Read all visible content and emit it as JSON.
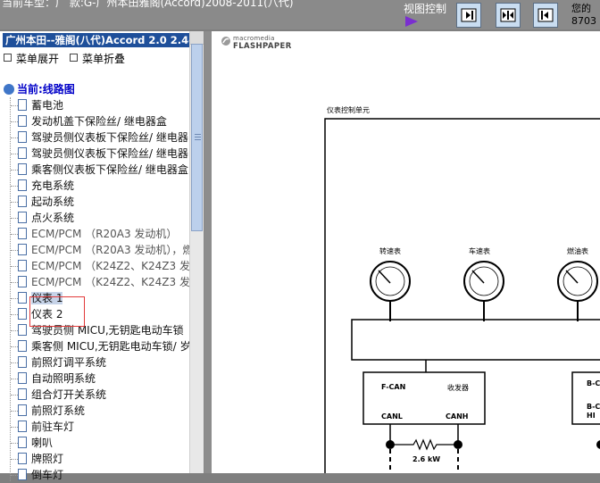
{
  "header": {
    "title": "当前车型：广 款:G-广州本田雅阁(Accord)2008-2011(八代)",
    "view_control_label": "视图控制",
    "right_text_1": "您的",
    "right_text_2": "8703"
  },
  "sidebar": {
    "selected_model": "广州本田--雅阁(八代)Accord 2.0 2.4-",
    "expand_label": "菜单展开",
    "collapse_label": "菜单折叠",
    "tree_root": "当前:线路图",
    "items": [
      {
        "label": "蓄电池"
      },
      {
        "label": "发动机盖下保险丝/ 继电器盒"
      },
      {
        "label": "驾驶员侧仪表板下保险丝/ 继电器"
      },
      {
        "label": "驾驶员侧仪表板下保险丝/ 继电器"
      },
      {
        "label": "乘客侧仪表板下保险丝/ 继电器盒"
      },
      {
        "label": "充电系统"
      },
      {
        "label": "起动系统"
      },
      {
        "label": "点火系统"
      },
      {
        "label": "ECM/PCM （R20A3 发动机）"
      },
      {
        "label": "ECM/PCM （R20A3 发动机），燃"
      },
      {
        "label": "ECM/PCM （K24Z2、K24Z3 发"
      },
      {
        "label": "ECM/PCM （K24Z2、K24Z3 发"
      },
      {
        "label": "仪表 1"
      },
      {
        "label": "仪表 2"
      },
      {
        "label": "驾驶员侧 MICU,无钥匙电动车锁"
      },
      {
        "label": "乘客侧 MICU,无钥匙电动车锁/ 岁"
      },
      {
        "label": "前照灯调平系统"
      },
      {
        "label": "自动照明系统"
      },
      {
        "label": "组合灯开关系统"
      },
      {
        "label": "前照灯系统"
      },
      {
        "label": "前驻车灯"
      },
      {
        "label": "喇叭"
      },
      {
        "label": "牌照灯"
      },
      {
        "label": "倒车灯"
      }
    ]
  },
  "viewer": {
    "brand_small": "macromedia",
    "brand_big": "FLASHPAPER",
    "diagram_title": "仪表控制单元",
    "gauges": [
      "转速表",
      "车速表",
      "燃油表"
    ],
    "box1_tl": "F-CAN",
    "box1_tr": "收发器",
    "box1_bl": "CANL",
    "box1_br": "CANH",
    "box2_t": "B-C",
    "box2_b1": "B-C",
    "box2_b2": "HI",
    "resistor": "2.6 kW"
  }
}
